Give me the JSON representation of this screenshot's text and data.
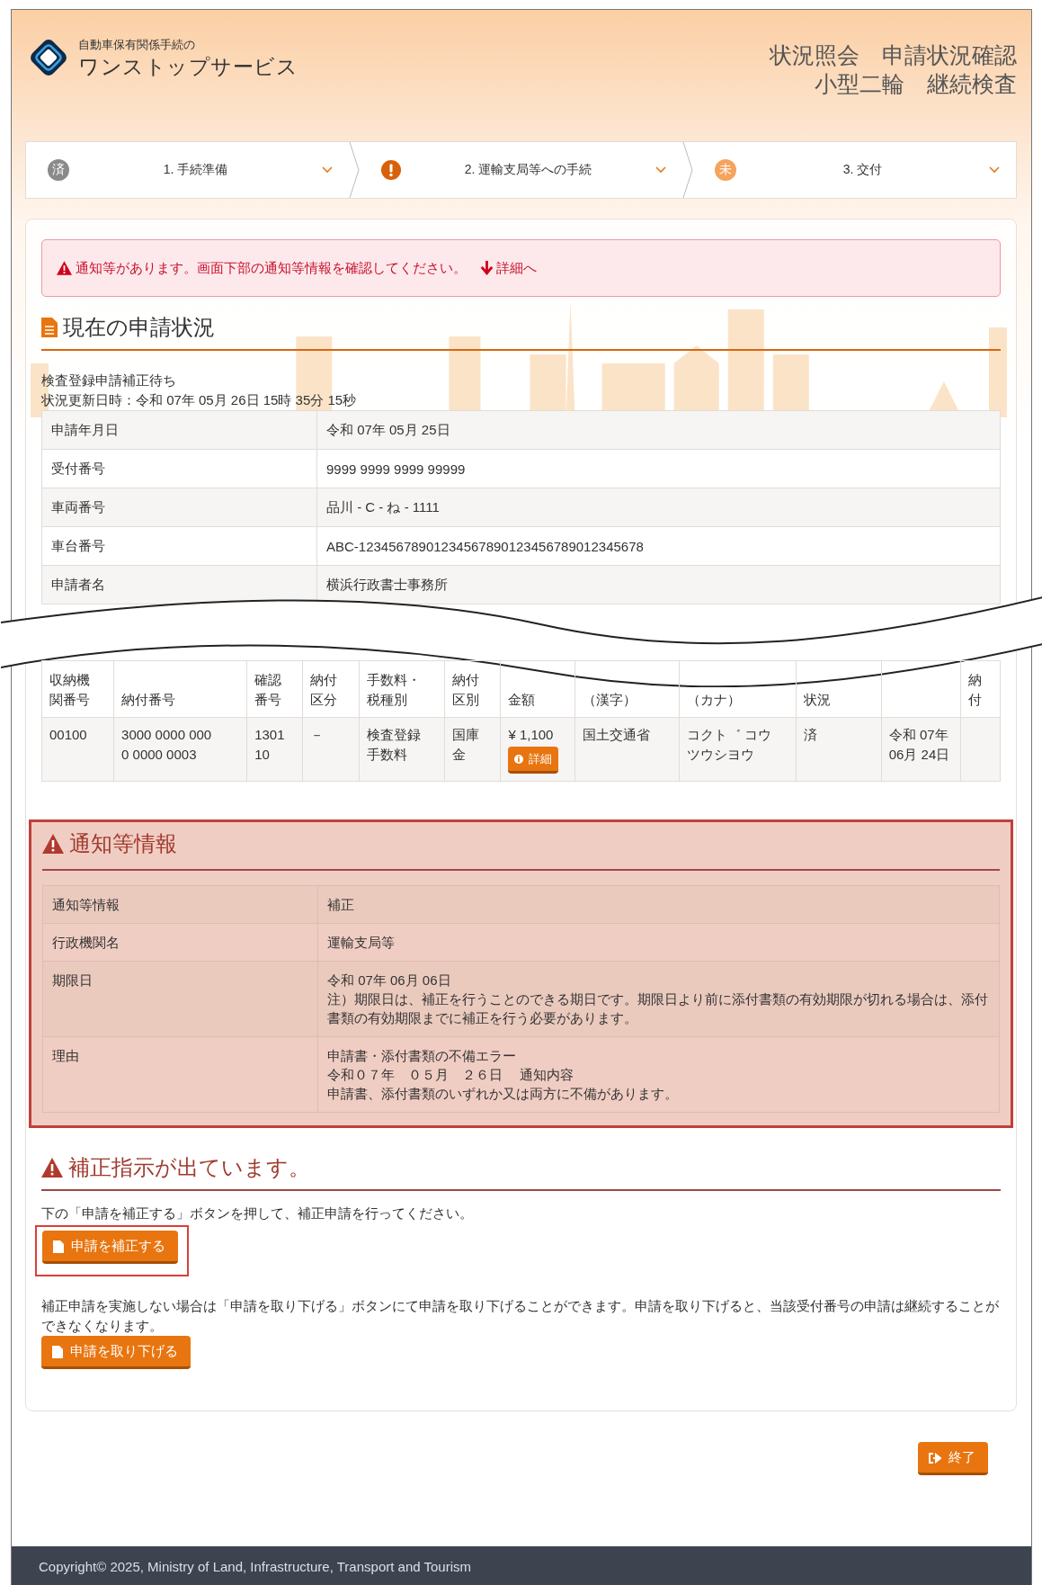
{
  "header": {
    "logo_subtitle": "自動車保有関係手続の",
    "logo_title": "ワンストップサービス",
    "title_lines": [
      "状況照会　申請状況確認",
      "小型二輪　継続検査"
    ]
  },
  "steps": [
    {
      "kind": "done",
      "badge": "済",
      "label": "1. 手続準備"
    },
    {
      "kind": "alert",
      "label": "2. 運輸支局等への手続"
    },
    {
      "kind": "pending",
      "badge": "未",
      "label": "3. 交付"
    }
  ],
  "alert": {
    "message": "通知等があります。画面下部の通知等情報を確認してください。",
    "link": "詳細へ"
  },
  "status_section": {
    "title": "現在の申請状況",
    "status": "検査登録申請補正待ち",
    "updated": "状況更新日時：令和 07年 05月 26日 15時 35分 15秒",
    "rows": [
      {
        "label": "申請年月日",
        "value": "令和 07年 05月 25日"
      },
      {
        "label": "受付番号",
        "value": "9999 9999 9999 99999"
      },
      {
        "label": "車両番号",
        "value": "品川 - C - ね - 1111"
      },
      {
        "label": "車台番号",
        "value": "ABC-12345678901234567890123456789012345678"
      },
      {
        "label": "申請者名",
        "value": "横浜行政書士事務所"
      }
    ]
  },
  "fee_table": {
    "columns": [
      {
        "label": "収納機関番号"
      },
      {
        "label": "納付番号"
      },
      {
        "label": "確認番号"
      },
      {
        "label": "納付区分"
      },
      {
        "label": "手数料・税種別"
      },
      {
        "label": "納付区別"
      },
      {
        "label": "金額"
      },
      {
        "label": "（漢字）"
      },
      {
        "label": "（カナ）"
      },
      {
        "label": "状況"
      },
      {},
      {
        "label": "納付"
      }
    ],
    "rows": [
      [
        {
          "text": "00100"
        },
        {
          "text": "3000 0000 000\n0 0000 0003"
        },
        {
          "text": "1301\n10"
        },
        {
          "text": "－"
        },
        {
          "text": "検査登録手数料"
        },
        {
          "text": "国庫金"
        },
        {
          "text": "¥ 1,100",
          "button": "詳細"
        },
        {
          "text": "国土交通省"
        },
        {
          "text": "コクト゛ コウツウシヨウ"
        },
        {
          "text": "済"
        },
        {
          "text": "令和 07年 06月 24日"
        },
        {}
      ]
    ]
  },
  "notice": {
    "title": "通知等情報",
    "rows": [
      {
        "label": "通知等情報",
        "lines": [
          "補正"
        ]
      },
      {
        "label": "行政機関名",
        "lines": [
          "運輸支局等"
        ]
      },
      {
        "label": "期限日",
        "lines": [
          "令和 07年 06月 06日",
          "注）期限日は、補正を行うことのできる期日です。期限日より前に添付書類の有効期限が切れる場合は、添付書類の有効期限までに補正を行う必要があります。"
        ]
      },
      {
        "label": "理由",
        "lines": [
          "申請書・添付書類の不備エラー",
          "令和０７年　０５月　２６日　 通知内容",
          "申請書、添付書類のいずれか又は両方に不備があります。"
        ]
      }
    ]
  },
  "correction": {
    "title": "補正指示が出ています。",
    "instruction": "下の「申請を補正する」ボタンを押して、補正申請を行ってください。",
    "correct_button": "申請を補正する",
    "withdraw_text": "補正申請を実施しない場合は「申請を取り下げる」ボタンにて申請を取り下げることができます。申請を取り下げると、当該受付番号の申請は継続することができなくなります。",
    "withdraw_button": "申請を取り下げる"
  },
  "end_button": "終了",
  "footer": "Copyright© 2025, Ministry of Land, Infrastructure, Transport and Tourism"
}
